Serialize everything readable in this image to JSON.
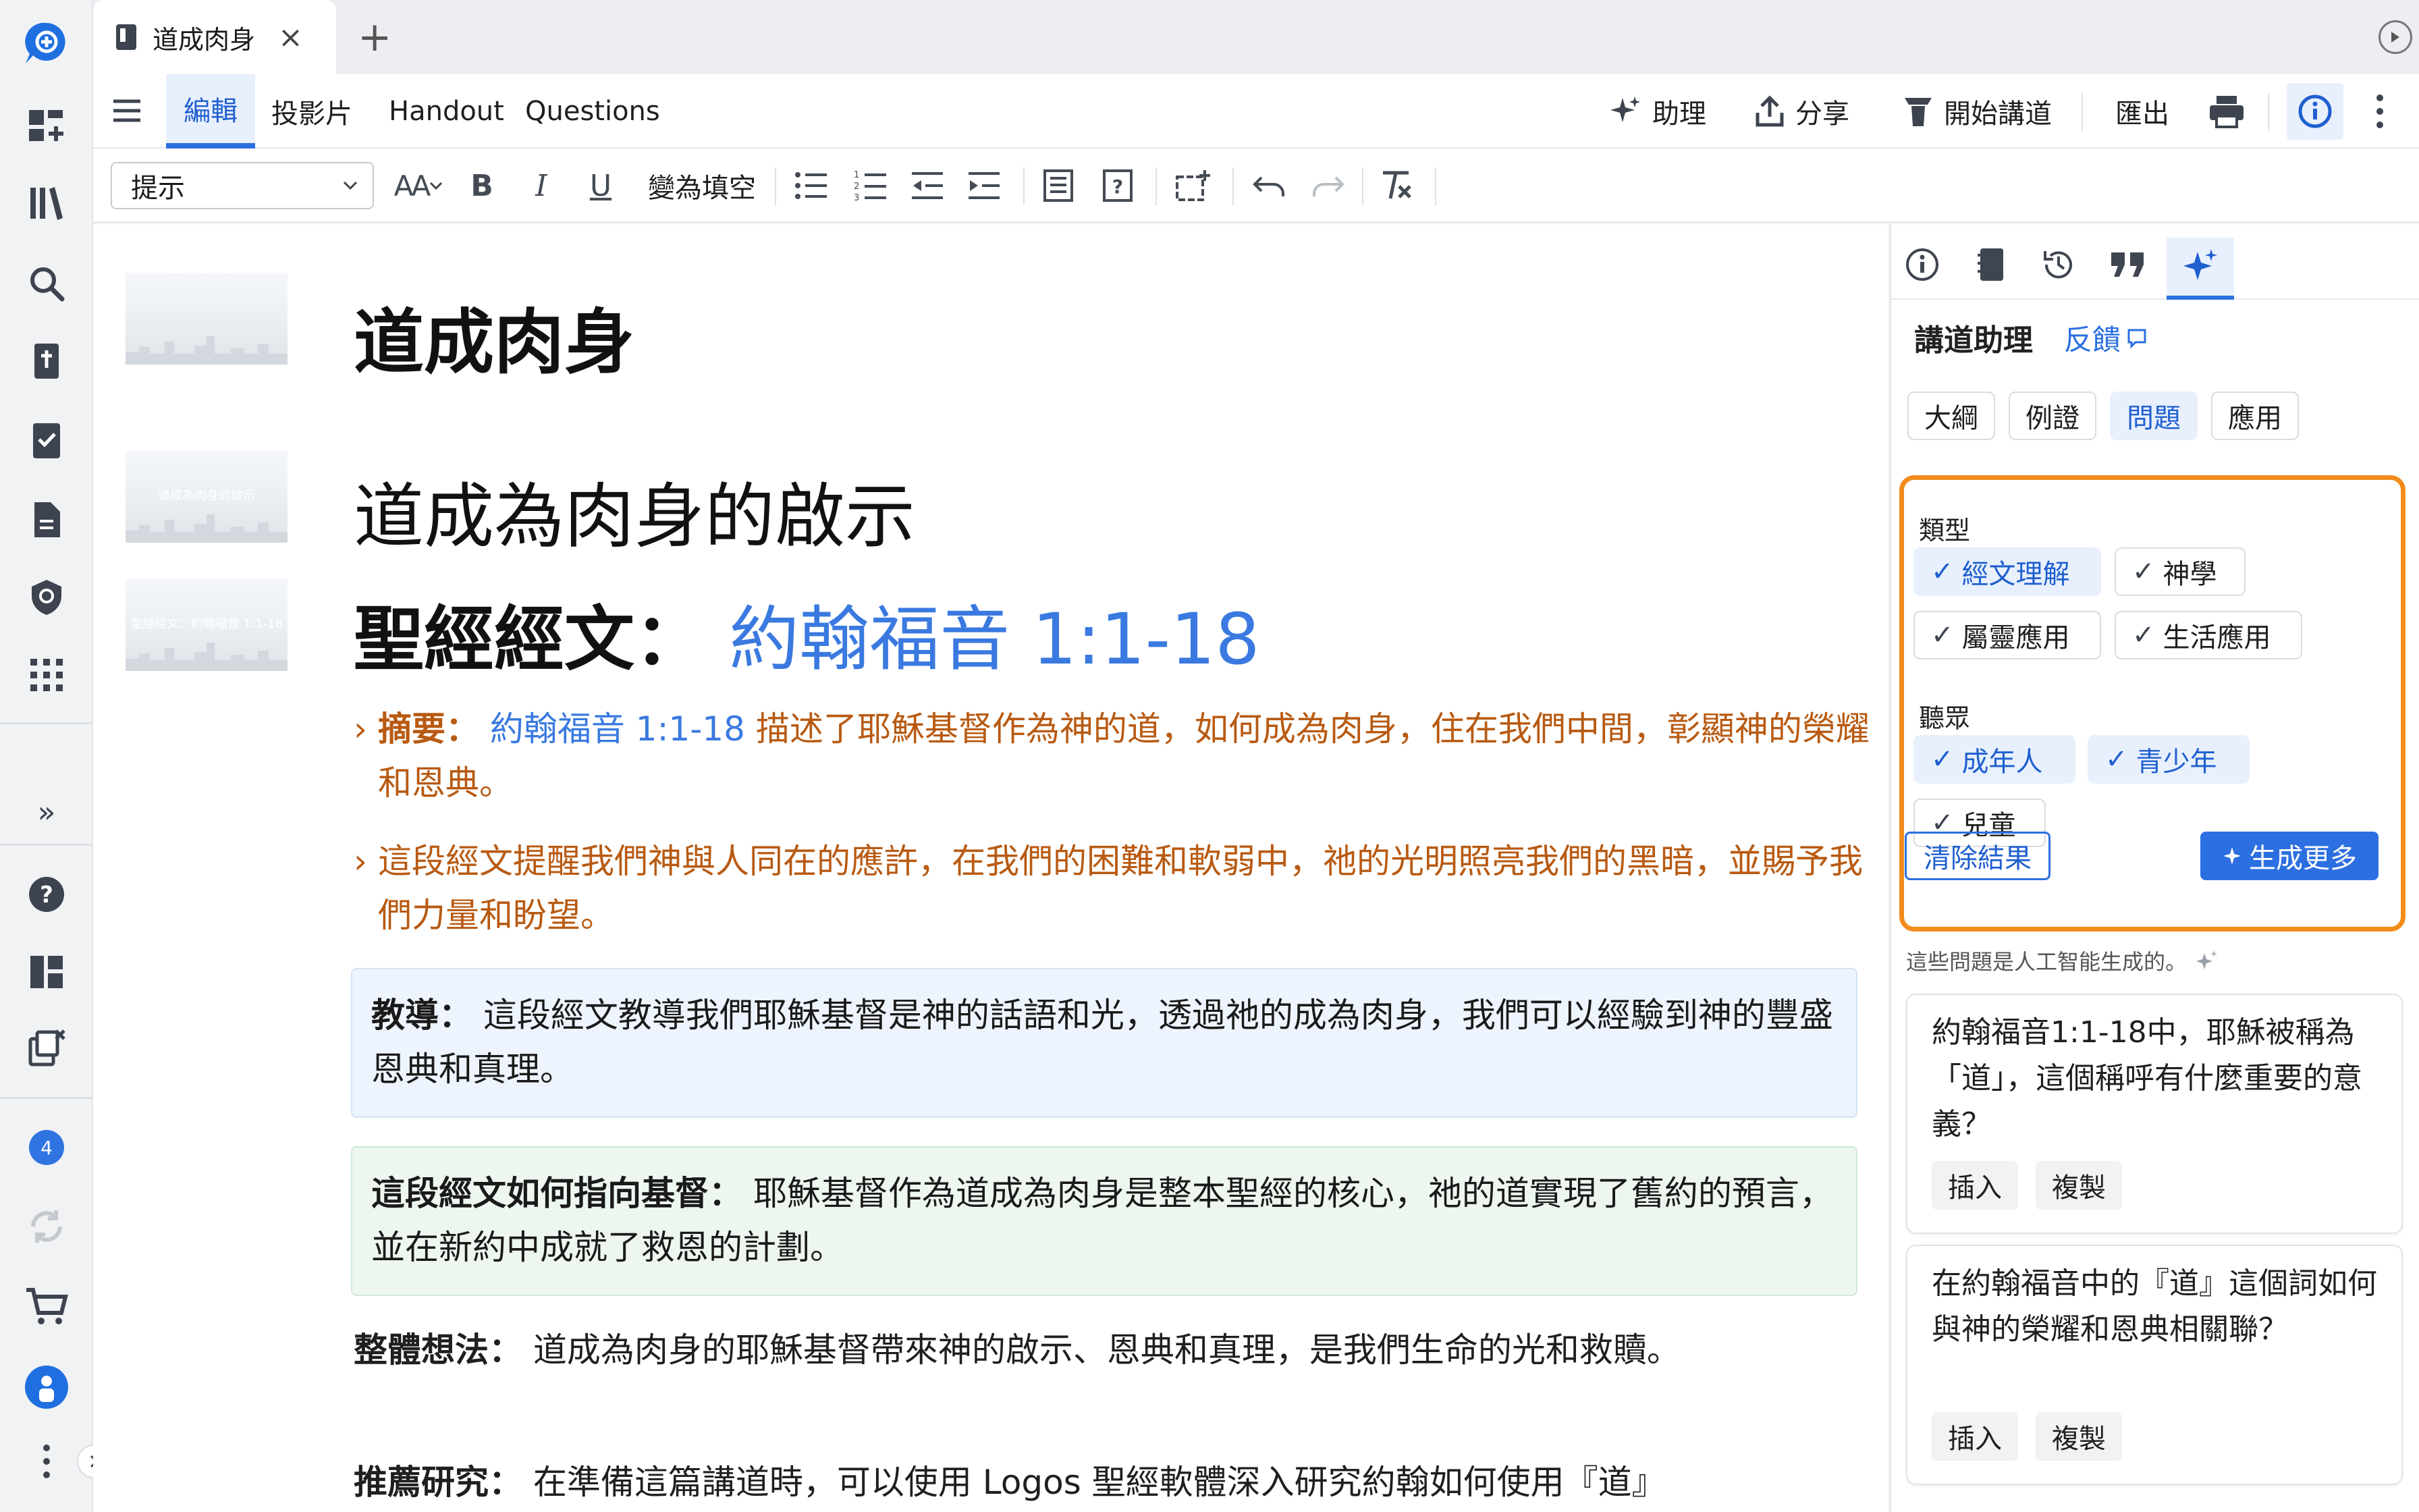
{
  "tab": {
    "title": "道成肉身",
    "close": "×",
    "add": "+"
  },
  "menu": {
    "edit": "編輯",
    "slides": "投影片",
    "handout": "Handout",
    "questions": "Questions",
    "assistant": "助理",
    "share": "分享",
    "start_preaching": "開始講道",
    "export": "匯出"
  },
  "toolbar": {
    "style_value": "提示",
    "font_size": "AA",
    "bold": "B",
    "italic": "I",
    "underline": "U",
    "fill_blank": "變為填空"
  },
  "document": {
    "title": "道成肉身",
    "subtitle": "道成為肉身的啟示",
    "scripture_label": "聖經經文：",
    "scripture_ref": "約翰福音 1:1-18",
    "slide_thumbs": [
      "",
      "道成為肉身的啟示",
      "聖經經文：約翰福音 1:1-18"
    ],
    "summary_label": "摘要：",
    "summary_ref": "約翰福音 1:1-18",
    "summary_text": "描述了耶穌基督作為神的道，如何成為肉身，住在我們中間，彰顯神的榮耀和恩典。",
    "bullet2": "這段經文提醒我們神與人同在的應許，在我們的困難和軟弱中，祂的光明照亮我們的黑暗，並賜予我們力量和盼望。",
    "teaching_label": "教導：",
    "teaching_text": "這段經文教導我們耶穌基督是神的話語和光，透過祂的成為肉身，我們可以經驗到神的豐盛恩典和真理。",
    "christ_label": "這段經文如何指向基督：",
    "christ_text": "耶穌基督作為道成為肉身是整本聖經的核心，祂的道實現了舊約的預言，並在新約中成就了救恩的計劃。",
    "overall_label": "整體想法：",
    "overall_text": "道成為肉身的耶穌基督帶來神的啟示、恩典和真理，是我們生命的光和救贖。",
    "study_label": "推薦研究：",
    "study_text": "在準備這篇講道時，可以使用 Logos 聖經軟體深入研究約翰如何使用『道』"
  },
  "panel": {
    "title": "講道助理",
    "feedback": "反饋",
    "tabs": [
      "大綱",
      "例證",
      "問題",
      "應用"
    ],
    "active_tab": "問題",
    "type_label": "類型",
    "types": [
      {
        "label": "經文理解",
        "selected": true
      },
      {
        "label": "神學",
        "selected": false
      },
      {
        "label": "屬靈應用",
        "selected": false
      },
      {
        "label": "生活應用",
        "selected": false
      }
    ],
    "audience_label": "聽眾",
    "audiences": [
      {
        "label": "成年人",
        "selected": true
      },
      {
        "label": "青少年",
        "selected": true
      },
      {
        "label": "兒童",
        "selected": false
      }
    ],
    "clear": "清除結果",
    "generate": "生成更多",
    "ai_note": "這些問題是人工智能生成的。",
    "questions": [
      {
        "text": "約翰福音1:1-18中，耶穌被稱為「道」，這個稱呼有什麼重要的意義？",
        "insert": "插入",
        "copy": "複製"
      },
      {
        "text": "在約翰福音中的『道』這個詞如何與神的榮耀和恩典相關聯？",
        "insert": "插入",
        "copy": "複製"
      }
    ]
  },
  "rail": {
    "badge": "4",
    "expand": "»"
  },
  "colors": {
    "accent": "#2c6fe0",
    "highlight_border": "#f28c1c",
    "summary": "#b85a12",
    "link": "#3a7ae0"
  }
}
